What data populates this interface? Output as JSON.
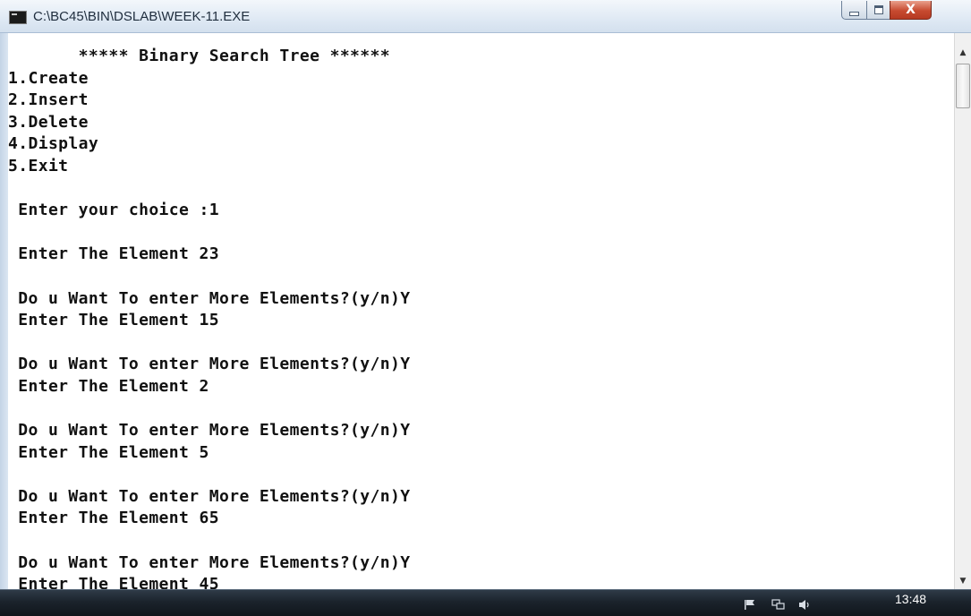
{
  "window": {
    "title": "C:\\BC45\\BIN\\DSLAB\\WEEK-11.EXE",
    "app_icon": "console-app-icon",
    "controls": {
      "minimize_icon": "minimize-icon",
      "maximize_icon": "maximize-icon",
      "close_icon": "close-icon",
      "close_glyph": "X"
    }
  },
  "console": {
    "lines": [
      "       ***** Binary Search Tree ******",
      "1.Create",
      "2.Insert",
      "3.Delete",
      "4.Display",
      "5.Exit",
      "",
      " Enter your choice :1",
      "",
      " Enter The Element 23",
      "",
      " Do u Want To enter More Elements?(y/n)Y",
      " Enter The Element 15",
      "",
      " Do u Want To enter More Elements?(y/n)Y",
      " Enter The Element 2",
      "",
      " Do u Want To enter More Elements?(y/n)Y",
      " Enter The Element 5",
      "",
      " Do u Want To enter More Elements?(y/n)Y",
      " Enter The Element 65",
      "",
      " Do u Want To enter More Elements?(y/n)Y",
      " Enter The Element 45"
    ],
    "text_color": "#111111",
    "background": "#ffffff"
  },
  "scrollbar": {
    "up_arrow": "▲",
    "down_arrow": "▼",
    "icons": [
      "scroll-up-arrow-icon",
      "scroll-down-arrow-icon"
    ]
  },
  "taskbar": {
    "clock": "13:48",
    "tray_icons": [
      "flag-icon",
      "network-icon",
      "volume-icon"
    ]
  }
}
